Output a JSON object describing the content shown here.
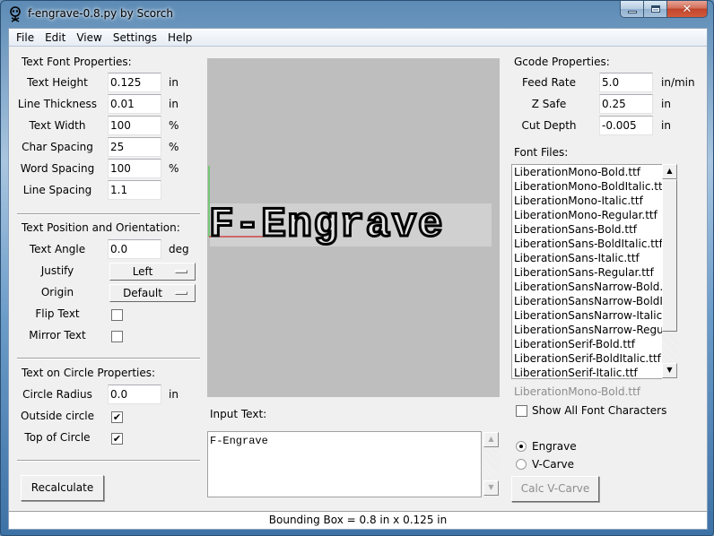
{
  "window": {
    "title": "f-engrave-0.8.py by Scorch",
    "controls": {
      "minimize": "minimize",
      "maximize": "maximize",
      "close": "✕"
    }
  },
  "menu": [
    "File",
    "Edit",
    "View",
    "Settings",
    "Help"
  ],
  "text_font": {
    "header": "Text Font Properties:",
    "fields": [
      {
        "label": "Text Height",
        "value": "0.125",
        "unit": "in"
      },
      {
        "label": "Line Thickness",
        "value": "0.01",
        "unit": "in"
      },
      {
        "label": "Text Width",
        "value": "100",
        "unit": "%"
      },
      {
        "label": "Char Spacing",
        "value": "25",
        "unit": "%"
      },
      {
        "label": "Word Spacing",
        "value": "100",
        "unit": "%"
      },
      {
        "label": "Line Spacing",
        "value": "1.1",
        "unit": ""
      }
    ]
  },
  "text_position": {
    "header": "Text Position and Orientation:",
    "angle": {
      "label": "Text Angle",
      "value": "0.0",
      "unit": "deg"
    },
    "justify": {
      "label": "Justify",
      "value": "Left"
    },
    "origin": {
      "label": "Origin",
      "value": "Default"
    },
    "flip": {
      "label": "Flip Text",
      "checked": false
    },
    "mirror": {
      "label": "Mirror Text",
      "checked": false
    }
  },
  "circle": {
    "header": "Text on Circle Properties:",
    "radius": {
      "label": "Circle Radius",
      "value": "0.0",
      "unit": "in"
    },
    "outside": {
      "label": "Outside circle",
      "checked": true,
      "mark": "✔"
    },
    "top": {
      "label": "Top of Circle",
      "checked": true,
      "mark": "✔"
    }
  },
  "recalculate_label": "Recalculate",
  "preview": {
    "text": "F-Engrave",
    "x_axis_color": "#cc0000",
    "y_axis_color": "#33cc33",
    "background": "#bebebe",
    "text_bbox_color": "#d0d0d0"
  },
  "input_text": {
    "label": "Input Text:",
    "value": "F-Engrave"
  },
  "gcode": {
    "header": "Gcode Properties:",
    "fields": [
      {
        "label": "Feed Rate",
        "value": "5.0",
        "unit": "in/min"
      },
      {
        "label": "Z Safe",
        "value": "0.25",
        "unit": "in"
      },
      {
        "label": "Cut Depth",
        "value": "-0.005",
        "unit": "in"
      }
    ]
  },
  "fonts": {
    "label": "Font Files:",
    "items": [
      "LiberationMono-Bold.ttf",
      "LiberationMono-BoldItalic.ttf",
      "LiberationMono-Italic.ttf",
      "LiberationMono-Regular.ttf",
      "LiberationSans-Bold.ttf",
      "LiberationSans-BoldItalic.ttf",
      "LiberationSans-Italic.ttf",
      "LiberationSans-Regular.ttf",
      "LiberationSansNarrow-Bold.ttf",
      "LiberationSansNarrow-BoldItalic.ttf",
      "LiberationSansNarrow-Italic.ttf",
      "LiberationSansNarrow-Regular.ttf",
      "LiberationSerif-Bold.ttf",
      "LiberationSerif-BoldItalic.ttf",
      "LiberationSerif-Italic.ttf"
    ],
    "selected": "LiberationMono-Bold.ttf",
    "show_all": {
      "label": "Show All Font Characters",
      "checked": false
    }
  },
  "mode": {
    "options": [
      {
        "label": "Engrave",
        "selected": true
      },
      {
        "label": "V-Carve",
        "selected": false
      }
    ],
    "calc_label": "Calc V-Carve"
  },
  "scroll": {
    "up": "▲",
    "down": "▼"
  },
  "status": "Bounding Box = 0.8 in  x 0.125 in"
}
